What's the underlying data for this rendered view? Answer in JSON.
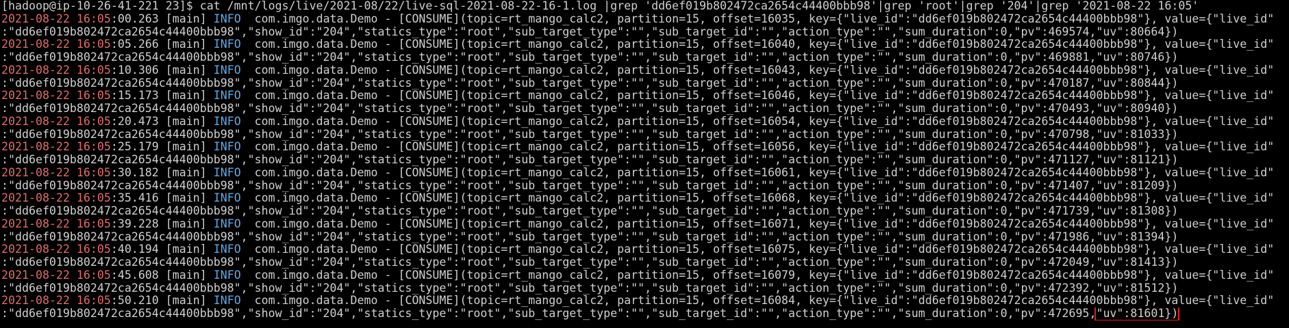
{
  "terminal": {
    "prompt": "[hadoop@ip-10-26-41-221 23]$ ",
    "command": "cat /mnt/logs/live/2021-08/22/live-sql-2021-08-22-16-1.log |grep 'dd6ef019b802472ca2654c44400bbb98'|grep 'root'|grep '204'|grep '2021-08-22 16:05'"
  },
  "colors": {
    "background": "#000000",
    "text": "#d0d0d0",
    "timestamp_highlight": "#e06c6c",
    "info_level": "#5aa9e6",
    "annotation_box": "#e01e1e"
  },
  "log": {
    "entries": [
      {
        "ts_hl": "2021-08-22 16:05",
        "ts_rest": ":00.263 [main] ",
        "level": "INFO",
        "msg": "  com.imgo.data.Demo - [CONSUME](topic=rt_mango_calc2, partition=15, offset=16035, key={\"live_id\":\"dd6ef019b802472ca2654c44400bbb98\"}, value={\"live_id\"",
        "cont": ":\"dd6ef019b802472ca2654c44400bbb98\",\"show_id\":\"204\",\"statics_type\":\"root\",\"sub_target_type\":\"\",\"sub_target_id\":\"\",\"action_type\":\"\",\"sum_duration\":0,\"pv\":469574,\"uv\":80664})"
      },
      {
        "ts_hl": "2021-08-22 16:05",
        "ts_rest": ":05.266 [main] ",
        "level": "INFO",
        "msg": "  com.imgo.data.Demo - [CONSUME](topic=rt_mango_calc2, partition=15, offset=16040, key={\"live_id\":\"dd6ef019b802472ca2654c44400bbb98\"}, value={\"live_id\"",
        "cont": ":\"dd6ef019b802472ca2654c44400bbb98\",\"show_id\":\"204\",\"statics_type\":\"root\",\"sub_target_type\":\"\",\"sub_target_id\":\"\",\"action_type\":\"\",\"sum_duration\":0,\"pv\":469881,\"uv\":80746})"
      },
      {
        "ts_hl": "2021-08-22 16:05",
        "ts_rest": ":10.306 [main] ",
        "level": "INFO",
        "msg": "  com.imgo.data.Demo - [CONSUME](topic=rt_mango_calc2, partition=15, offset=16043, key={\"live_id\":\"dd6ef019b802472ca2654c44400bbb98\"}, value={\"live_id\"",
        "cont": ":\"dd6ef019b802472ca2654c44400bbb98\",\"show_id\":\"204\",\"statics_type\":\"root\",\"sub_target_type\":\"\",\"sub_target_id\":\"\",\"action_type\":\"\",\"sum_duration\":0,\"pv\":470187,\"uv\":80844})"
      },
      {
        "ts_hl": "2021-08-22 16:05",
        "ts_rest": ":15.173 [main] ",
        "level": "INFO",
        "msg": "  com.imgo.data.Demo - [CONSUME](topic=rt_mango_calc2, partition=15, offset=16046, key={\"live_id\":\"dd6ef019b802472ca2654c44400bbb98\"}, value={\"live_id\"",
        "cont": ":\"dd6ef019b802472ca2654c44400bbb98\",\"show_id\":\"204\",\"statics_type\":\"root\",\"sub_target_type\":\"\",\"sub_target_id\":\"\",\"action_type\":\"\",\"sum_duration\":0,\"pv\":470493,\"uv\":80940})"
      },
      {
        "ts_hl": "2021-08-22 16:05",
        "ts_rest": ":20.473 [main] ",
        "level": "INFO",
        "msg": "  com.imgo.data.Demo - [CONSUME](topic=rt_mango_calc2, partition=15, offset=16054, key={\"live_id\":\"dd6ef019b802472ca2654c44400bbb98\"}, value={\"live_id\"",
        "cont": ":\"dd6ef019b802472ca2654c44400bbb98\",\"show_id\":\"204\",\"statics_type\":\"root\",\"sub_target_type\":\"\",\"sub_target_id\":\"\",\"action_type\":\"\",\"sum_duration\":0,\"pv\":470798,\"uv\":81033})"
      },
      {
        "ts_hl": "2021-08-22 16:05",
        "ts_rest": ":25.179 [main] ",
        "level": "INFO",
        "msg": "  com.imgo.data.Demo - [CONSUME](topic=rt_mango_calc2, partition=15, offset=16056, key={\"live_id\":\"dd6ef019b802472ca2654c44400bbb98\"}, value={\"live_id\"",
        "cont": ":\"dd6ef019b802472ca2654c44400bbb98\",\"show_id\":\"204\",\"statics_type\":\"root\",\"sub_target_type\":\"\",\"sub_target_id\":\"\",\"action_type\":\"\",\"sum_duration\":0,\"pv\":471127,\"uv\":81121})"
      },
      {
        "ts_hl": "2021-08-22 16:05",
        "ts_rest": ":30.182 [main] ",
        "level": "INFO",
        "msg": "  com.imgo.data.Demo - [CONSUME](topic=rt_mango_calc2, partition=15, offset=16061, key={\"live_id\":\"dd6ef019b802472ca2654c44400bbb98\"}, value={\"live_id\"",
        "cont": ":\"dd6ef019b802472ca2654c44400bbb98\",\"show_id\":\"204\",\"statics_type\":\"root\",\"sub_target_type\":\"\",\"sub_target_id\":\"\",\"action_type\":\"\",\"sum_duration\":0,\"pv\":471407,\"uv\":81209})"
      },
      {
        "ts_hl": "2021-08-22 16:05",
        "ts_rest": ":35.416 [main] ",
        "level": "INFO",
        "msg": "  com.imgo.data.Demo - [CONSUME](topic=rt_mango_calc2, partition=15, offset=16068, key={\"live_id\":\"dd6ef019b802472ca2654c44400bbb98\"}, value={\"live_id\"",
        "cont": ":\"dd6ef019b802472ca2654c44400bbb98\",\"show_id\":\"204\",\"statics_type\":\"root\",\"sub_target_type\":\"\",\"sub_target_id\":\"\",\"action_type\":\"\",\"sum_duration\":0,\"pv\":471739,\"uv\":81308})"
      },
      {
        "ts_hl": "2021-08-22 16:05",
        "ts_rest": ":39.228 [main] ",
        "level": "INFO",
        "msg": "  com.imgo.data.Demo - [CONSUME](topic=rt_mango_calc2, partition=15, offset=16071, key={\"live_id\":\"dd6ef019b802472ca2654c44400bbb98\"}, value={\"live_id\"",
        "cont": ":\"dd6ef019b802472ca2654c44400bbb98\",\"show_id\":\"204\",\"statics_type\":\"root\",\"sub_target_type\":\"\",\"sub_target_id\":\"\",\"action_type\":\"\",\"sum_duration\":0,\"pv\":471986,\"uv\":81394})"
      },
      {
        "ts_hl": "2021-08-22 16:05",
        "ts_rest": ":40.194 [main] ",
        "level": "INFO",
        "msg": "  com.imgo.data.Demo - [CONSUME](topic=rt_mango_calc2, partition=15, offset=16075, key={\"live_id\":\"dd6ef019b802472ca2654c44400bbb98\"}, value={\"live_id\"",
        "cont": ":\"dd6ef019b802472ca2654c44400bbb98\",\"show_id\":\"204\",\"statics_type\":\"root\",\"sub_target_type\":\"\",\"sub_target_id\":\"\",\"action_type\":\"\",\"sum_duration\":0,\"pv\":472049,\"uv\":81413})"
      },
      {
        "ts_hl": "2021-08-22 16:05",
        "ts_rest": ":45.608 [main] ",
        "level": "INFO",
        "msg": "  com.imgo.data.Demo - [CONSUME](topic=rt_mango_calc2, partition=15, offset=16079, key={\"live_id\":\"dd6ef019b802472ca2654c44400bbb98\"}, value={\"live_id\"",
        "cont": ":\"dd6ef019b802472ca2654c44400bbb98\",\"show_id\":\"204\",\"statics_type\":\"root\",\"sub_target_type\":\"\",\"sub_target_id\":\"\",\"action_type\":\"\",\"sum_duration\":0,\"pv\":472392,\"uv\":81512})"
      },
      {
        "ts_hl": "2021-08-22 16:05",
        "ts_rest": ":50.210 [main] ",
        "level": "INFO",
        "msg": "  com.imgo.data.Demo - [CONSUME](topic=rt_mango_calc2, partition=15, offset=16084, key={\"live_id\":\"dd6ef019b802472ca2654c44400bbb98\"}, value={\"live_id\"",
        "cont": ":\"dd6ef019b802472ca2654c44400bbb98\",\"show_id\":\"204\",\"statics_type\":\"root\",\"sub_target_type\":\"\",\"sub_target_id\":\"\",\"action_type\":\"\",\"sum_duration\":0,\"pv\":472695,",
        "cont_highlight": "\"uv\":81601})"
      }
    ]
  }
}
